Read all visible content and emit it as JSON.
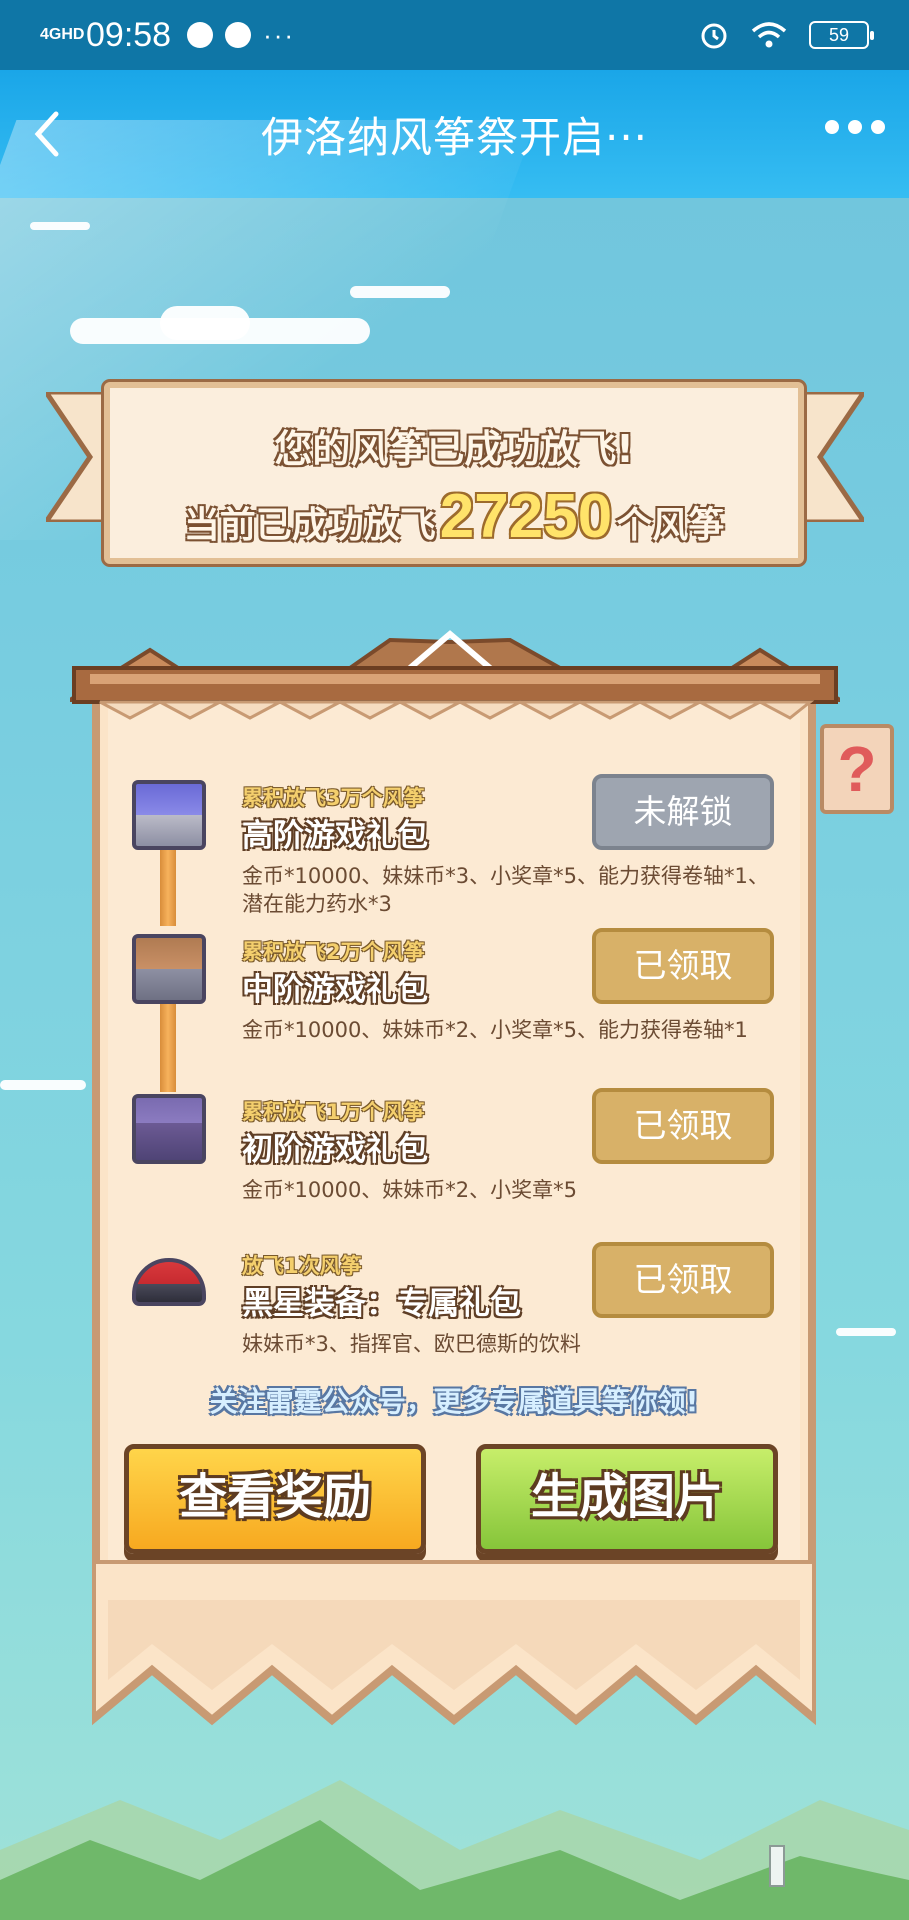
{
  "status_bar": {
    "network": "4GHD",
    "time": "09:58",
    "more": "···",
    "battery": "59"
  },
  "header": {
    "title": "伊洛纳风筝祭开启···"
  },
  "banner": {
    "line1": "您的风筝已成功放飞!",
    "line2_prefix": "当前已成功放飞",
    "count": "27250",
    "line2_suffix": "个风筝"
  },
  "help": {
    "label": "?"
  },
  "tiers": [
    {
      "requirement": "累积放飞3万个风筝",
      "title": "高阶游戏礼包",
      "desc": "金币*10000、妹妹币*3、小奖章*5、能力获得卷轴*1、潜在能力药水*3",
      "button": "未解锁",
      "status": "locked",
      "icon": "silver-chest-icon"
    },
    {
      "requirement": "累积放飞2万个风筝",
      "title": "中阶游戏礼包",
      "desc": "金币*10000、妹妹币*2、小奖章*5、能力获得卷轴*1",
      "button": "已领取",
      "status": "claimed",
      "icon": "iron-chest-icon"
    },
    {
      "requirement": "累积放飞1万个风筝",
      "title": "初阶游戏礼包",
      "desc": "金币*10000、妹妹币*2、小奖章*5",
      "button": "已领取",
      "status": "claimed",
      "icon": "wooden-chest-icon"
    },
    {
      "requirement": "放飞1次风筝",
      "title": "黑星装备：专属礼包",
      "desc": "妹妹币*3、指挥官、欧巴德斯的饮料",
      "button": "已领取",
      "status": "claimed",
      "icon": "red-beret-icon"
    }
  ],
  "follow_text": "关注雷霆公众号，更多专属道具等你领!",
  "actions": {
    "view_rewards": "查看奖励",
    "generate_image": "生成图片"
  },
  "colors": {
    "header": "#1aa6e8",
    "status_bar": "#0f76a6",
    "claimed_button": "#d8b168",
    "locked_button": "#9ea5b0",
    "yellow_button": "#f7a920",
    "green_button": "#86c53a"
  }
}
